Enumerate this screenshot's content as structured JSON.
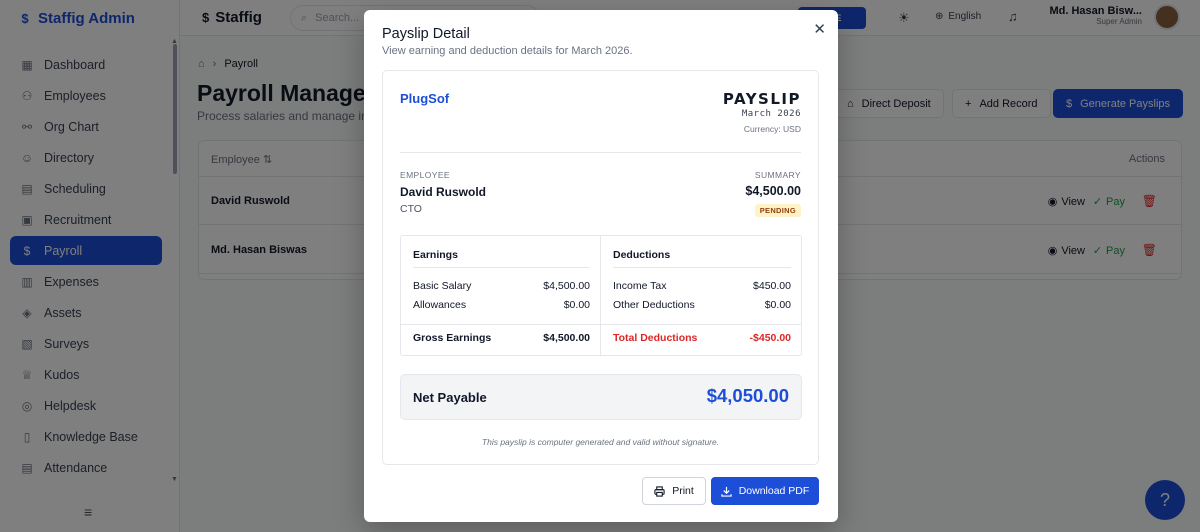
{
  "sidebar": {
    "brand": "Staffig Admin",
    "items": [
      {
        "label": "Dashboard",
        "icon": "grid-icon"
      },
      {
        "label": "Employees",
        "icon": "users-icon"
      },
      {
        "label": "Org Chart",
        "icon": "org-chart-icon"
      },
      {
        "label": "Directory",
        "icon": "directory-icon"
      },
      {
        "label": "Scheduling",
        "icon": "calendar-icon"
      },
      {
        "label": "Recruitment",
        "icon": "briefcase-icon"
      },
      {
        "label": "Payroll",
        "icon": "dollar-icon",
        "active": true
      },
      {
        "label": "Expenses",
        "icon": "receipt-icon"
      },
      {
        "label": "Assets",
        "icon": "box-icon"
      },
      {
        "label": "Surveys",
        "icon": "clipboard-icon"
      },
      {
        "label": "Kudos",
        "icon": "trophy-icon"
      },
      {
        "label": "Helpdesk",
        "icon": "lifebuoy-icon"
      },
      {
        "label": "Knowledge Base",
        "icon": "book-icon"
      },
      {
        "label": "Attendance",
        "icon": "calendar-check-icon"
      }
    ]
  },
  "topbar": {
    "brand": "Staffig",
    "search_placeholder": "Search...",
    "upgrade_label": "ADE",
    "language": "English",
    "user_name": "Md. Hasan Bisw...",
    "user_role": "Super Admin"
  },
  "page": {
    "breadcrumb": "Payroll",
    "title": "Payroll Managem",
    "subtitle": "Process salaries and manage in",
    "buttons": {
      "direct_deposit": "Direct Deposit",
      "add_record": "Add Record",
      "generate": "Generate Payslips"
    },
    "table": {
      "col_employee": "Employee",
      "col_actions": "Actions",
      "rows": [
        {
          "name": "David Ruswold",
          "view": "View",
          "pay": "Pay"
        },
        {
          "name": "Md. Hasan Biswas",
          "view": "View",
          "pay": "Pay"
        }
      ]
    }
  },
  "modal": {
    "title": "Payslip Detail",
    "subtitle": "View earning and deduction details for March 2026.",
    "company": "PlugSof",
    "doc_title": "PAYSLIP",
    "period": "March 2026",
    "currency": "Currency: USD",
    "employee_label": "EMPLOYEE",
    "employee_name": "David Ruswold",
    "employee_role": "CTO",
    "summary_label": "SUMMARY",
    "summary_value": "$4,500.00",
    "status": "PENDING",
    "earnings": {
      "heading": "Earnings",
      "items": [
        {
          "label": "Basic Salary",
          "value": "$4,500.00"
        },
        {
          "label": "Allowances",
          "value": "$0.00"
        }
      ],
      "total_label": "Gross Earnings",
      "total_value": "$4,500.00"
    },
    "deductions": {
      "heading": "Deductions",
      "items": [
        {
          "label": "Income Tax",
          "value": "$450.00"
        },
        {
          "label": "Other Deductions",
          "value": "$0.00"
        }
      ],
      "total_label": "Total Deductions",
      "total_value": "-$450.00"
    },
    "net_label": "Net Payable",
    "net_value": "$4,050.00",
    "note": "This payslip is computer generated and valid without signature.",
    "print_label": "Print",
    "download_label": "Download PDF"
  },
  "colors": {
    "accent": "#1d4ed8",
    "danger": "#dc2626",
    "success": "#16a34a",
    "pending_bg": "#fef3c7"
  }
}
